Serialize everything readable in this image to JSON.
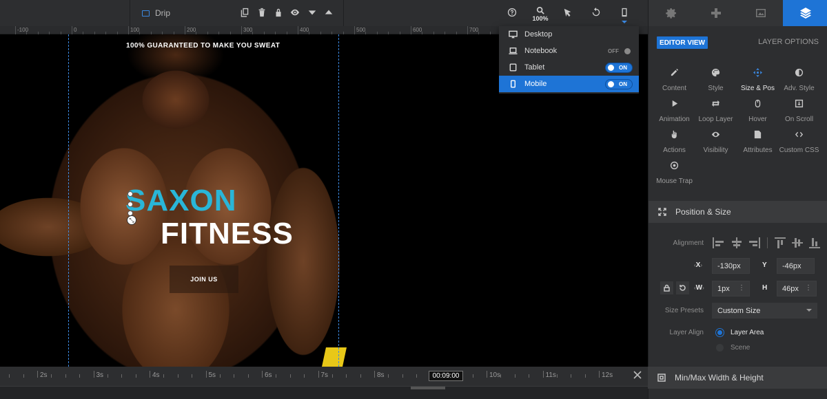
{
  "toolbar": {
    "layer_name": "Drip",
    "zoom": "100%"
  },
  "ruler": {
    "labels": [
      "-100",
      "0",
      "100",
      "200",
      "300",
      "400",
      "500",
      "600",
      "700"
    ]
  },
  "canvas": {
    "tagline": "100% GUARANTEED TO MAKE YOU SWEAT",
    "title_line1": "SAXON",
    "title_line2": "FITNESS",
    "button_label": "JOIN US",
    "accent_color": "#29b6d8"
  },
  "device_menu": {
    "items": [
      {
        "label": "Desktop",
        "icon": "desktop-icon",
        "toggle": ""
      },
      {
        "label": "Notebook",
        "icon": "laptop-icon",
        "toggle": "OFF"
      },
      {
        "label": "Tablet",
        "icon": "tablet-icon",
        "toggle": "ON"
      },
      {
        "label": "Mobile",
        "icon": "mobile-icon",
        "toggle": "ON"
      }
    ]
  },
  "timeline": {
    "labels": [
      "2s",
      "3s",
      "4s",
      "5s",
      "6s",
      "7s",
      "8s",
      "9s",
      "10s",
      "11s",
      "12s"
    ],
    "current_time": "00:09:00"
  },
  "panel": {
    "editor_view": "EDITOR VIEW",
    "layer_options": "LAYER OPTIONS",
    "tools": [
      {
        "label": "Content",
        "icon": "pencil-icon"
      },
      {
        "label": "Style",
        "icon": "palette-icon"
      },
      {
        "label": "Size & Pos",
        "icon": "move-icon",
        "active": true
      },
      {
        "label": "Adv. Style",
        "icon": "contrast-icon"
      },
      {
        "label": "Animation",
        "icon": "play-icon"
      },
      {
        "label": "Loop Layer",
        "icon": "loop-icon"
      },
      {
        "label": "Hover",
        "icon": "mouse-icon"
      },
      {
        "label": "On Scroll",
        "icon": "scroll-icon"
      },
      {
        "label": "Actions",
        "icon": "hand-icon"
      },
      {
        "label": "Visibility",
        "icon": "eye-icon"
      },
      {
        "label": "Attributes",
        "icon": "file-icon"
      },
      {
        "label": "Custom CSS",
        "icon": "code-icon"
      },
      {
        "label": "Mouse Trap",
        "icon": "target-icon"
      }
    ],
    "position_size": {
      "title": "Position & Size",
      "alignment_label": "Alignment",
      "x_label": "X",
      "x_value": "-130px",
      "y_label": "Y",
      "y_value": "-46px",
      "w_label": "W",
      "w_value": "1px",
      "h_label": "H",
      "h_value": "46px",
      "size_presets_label": "Size Presets",
      "size_preset_value": "Custom Size",
      "layer_align_label": "Layer Align",
      "layer_align_options": [
        "Layer Area",
        "Scene"
      ]
    },
    "minmax_title": "Min/Max Width & Height"
  }
}
